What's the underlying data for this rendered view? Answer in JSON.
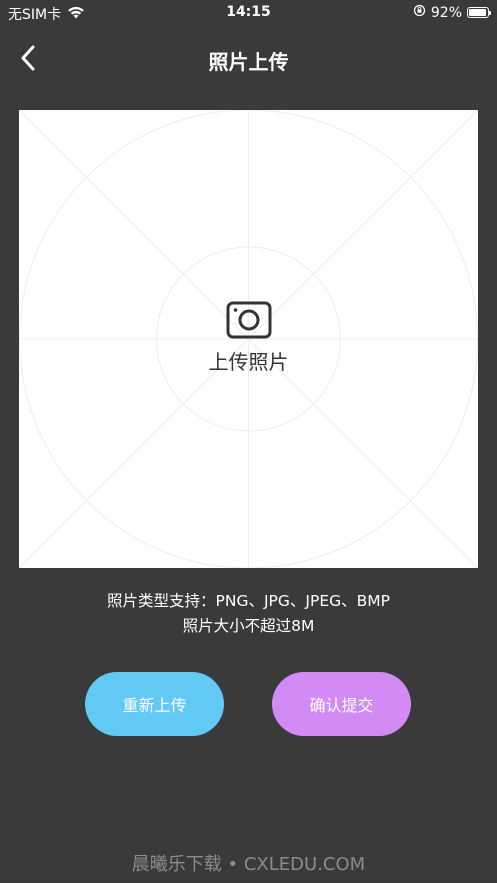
{
  "status_bar": {
    "carrier": "无SIM卡",
    "time": "14:15",
    "battery_percent": "92%",
    "battery_level": 0.92
  },
  "nav": {
    "title": "照片上传"
  },
  "upload": {
    "label": "上传照片"
  },
  "info": {
    "line1": "照片类型支持：PNG、JPG、JPEG、BMP",
    "line2": "照片大小不超过8M"
  },
  "buttons": {
    "reupload": "重新上传",
    "submit": "确认提交"
  },
  "watermark": "晨曦乐下载 • CXLEDU.COM",
  "colors": {
    "background": "#3a3a3a",
    "reupload": "#62c9f5",
    "submit": "#d28bf4"
  }
}
